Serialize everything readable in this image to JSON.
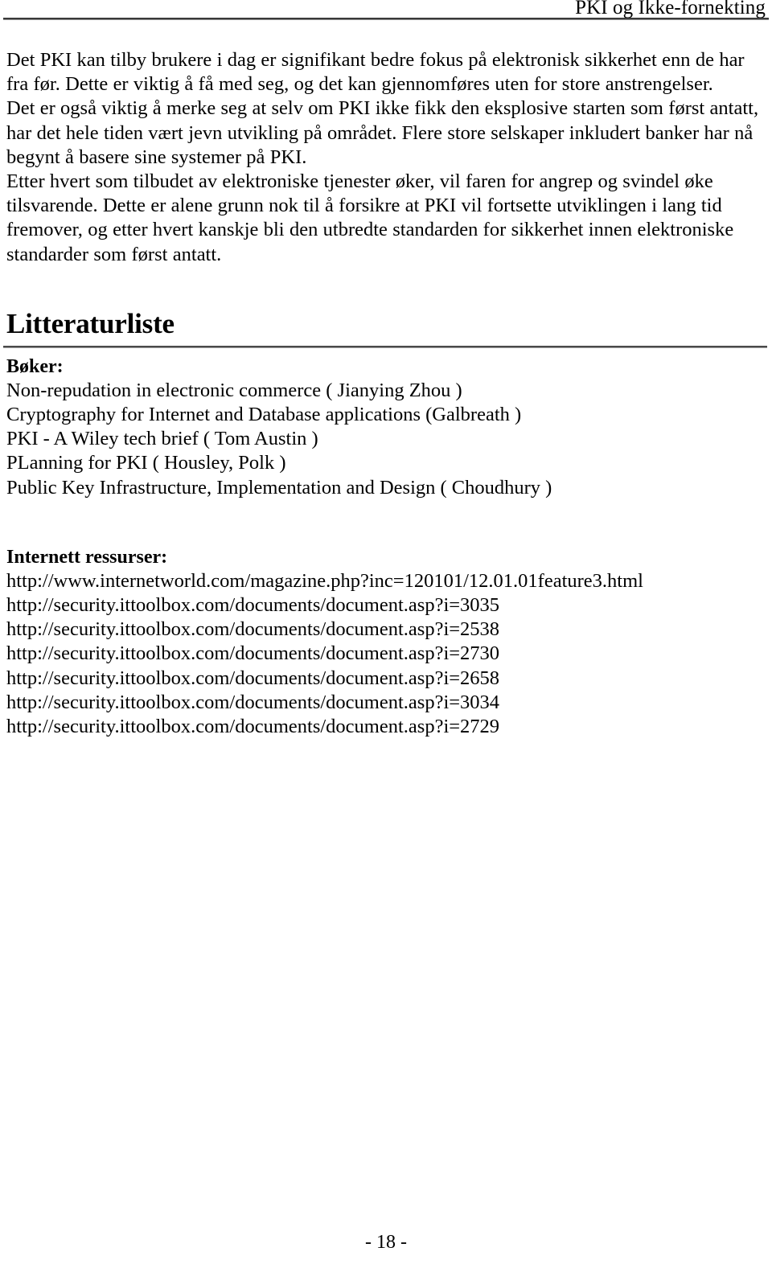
{
  "document": {
    "running_header": "PKI og Ikke-fornekting",
    "page_number_label": "- 18 -"
  },
  "body": {
    "paragraphs": [
      "Det PKI kan tilby brukere i dag er signifikant bedre fokus på elektronisk sikkerhet enn de har fra før. Dette er viktig å få med seg, og det kan gjennomføres uten for store anstrengelser.",
      "Det er også viktig å merke seg at selv om PKI ikke fikk den eksplosive starten som først antatt, har det hele tiden vært jevn utvikling på området. Flere store selskaper inkludert banker har nå begynt å basere sine systemer på PKI.",
      "Etter hvert som tilbudet av elektroniske tjenester øker, vil faren for angrep og svindel øke tilsvarende. Dette er alene grunn nok til å forsikre at PKI vil fortsette utviklingen i lang tid fremover, og etter hvert kanskje bli den utbredte standarden for sikkerhet innen elektroniske standarder som først antatt."
    ]
  },
  "bibliography": {
    "heading": "Litteraturliste",
    "books": {
      "label": "Bøker:",
      "items": [
        "Non-repudation in electronic commerce ( Jianying Zhou )",
        "Cryptography for Internet and Database applications  (Galbreath )",
        "PKI - A Wiley tech brief ( Tom Austin )",
        "PLanning for PKI ( Housley, Polk )",
        "Public Key Infrastructure, Implementation and Design ( Choudhury )"
      ]
    },
    "internet": {
      "label": "Internett ressurser:",
      "items": [
        "http://www.internetworld.com/magazine.php?inc=120101/12.01.01feature3.html",
        "http://security.ittoolbox.com/documents/document.asp?i=3035",
        "http://security.ittoolbox.com/documents/document.asp?i=2538",
        "http://security.ittoolbox.com/documents/document.asp?i=2730",
        "http://security.ittoolbox.com/documents/document.asp?i=2658",
        "http://security.ittoolbox.com/documents/document.asp?i=3034",
        "http://security.ittoolbox.com/documents/document.asp?i=2729"
      ]
    }
  }
}
